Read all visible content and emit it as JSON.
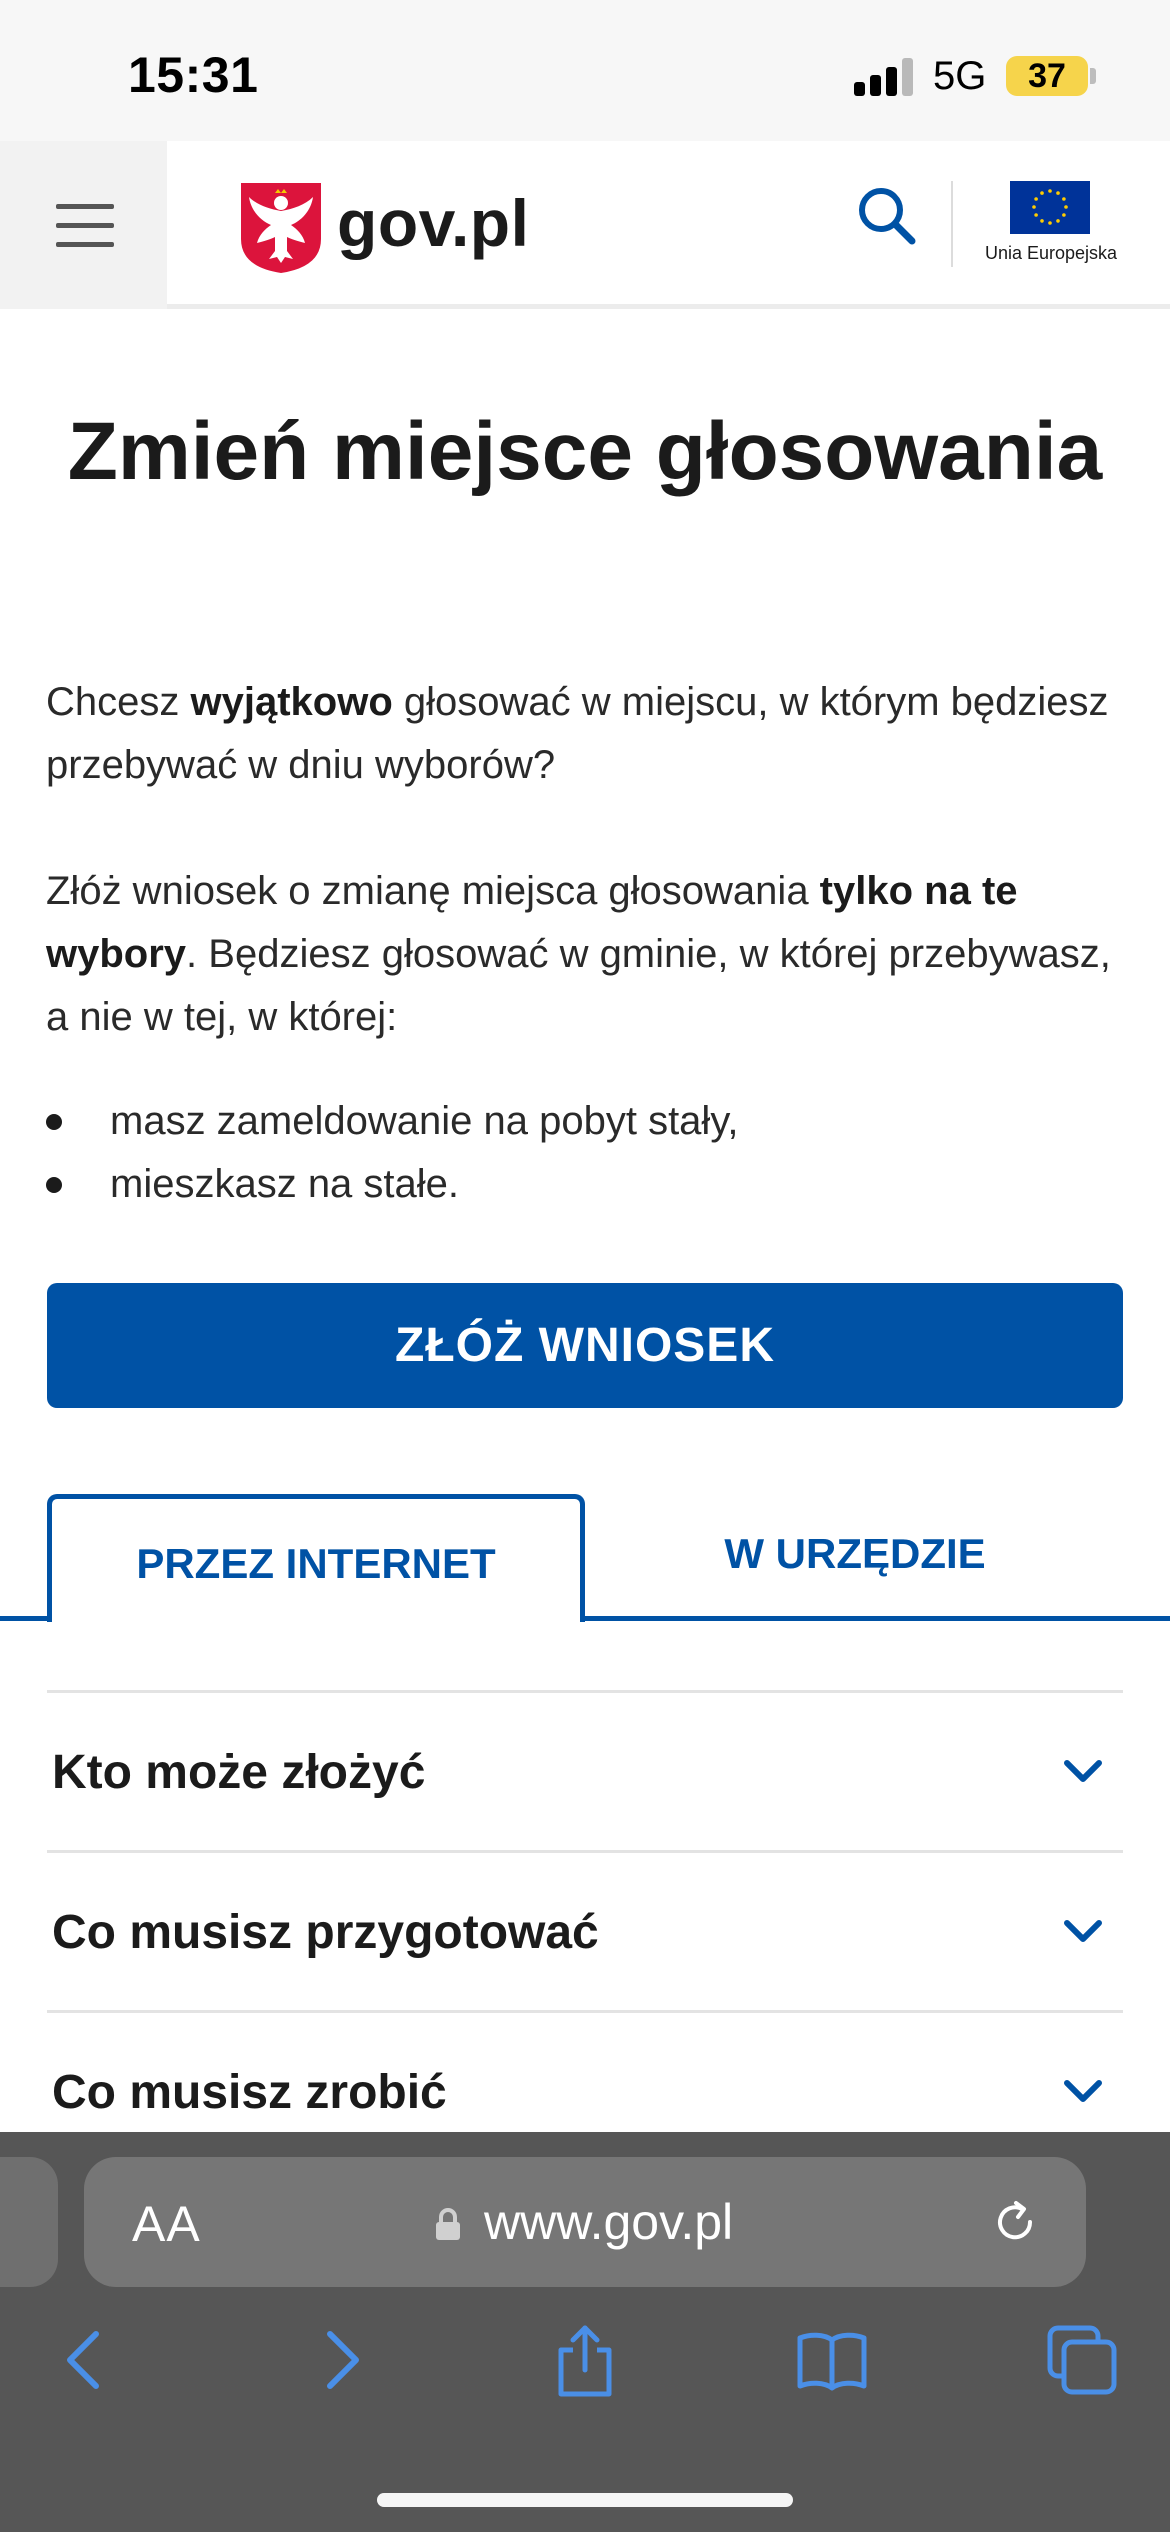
{
  "status_bar": {
    "time": "15:31",
    "network": "5G",
    "battery": "37"
  },
  "header": {
    "logo_text": "gov.pl",
    "eu_label": "Unia Europejska"
  },
  "main": {
    "title": "Zmień miejsce głosowania",
    "paragraph1": {
      "before": "Chcesz ",
      "bold": "wyjątkowo",
      "after": " głosować w miejscu, w którym będziesz przebywać w dniu wyborów?"
    },
    "paragraph2": {
      "before": "Złóż wniosek o zmianę miejsca głosowania ",
      "bold": "tylko na te wybory",
      "after": ". Będziesz głosować w gminie, w której przebywasz, a nie w tej, w której:"
    },
    "bullets": [
      "masz zameldowanie na pobyt stały,",
      "mieszkasz na stałe."
    ],
    "cta_label": "ZŁÓŻ WNIOSEK"
  },
  "tabs": [
    {
      "label": "PRZEZ INTERNET",
      "active": true
    },
    {
      "label": "W URZĘDZIE",
      "active": false
    }
  ],
  "accordion": [
    {
      "label": "Kto może złożyć"
    },
    {
      "label": "Co musisz przygotować"
    },
    {
      "label": "Co musisz zrobić"
    }
  ],
  "browser": {
    "text_size_label": "AA",
    "url": "www.gov.pl"
  },
  "colors": {
    "primary": "#0052a5",
    "text": "#1b1b1b",
    "battery": "#f6d44b",
    "browser_chrome": "#565656",
    "browser_icon": "#4a8fe7"
  }
}
